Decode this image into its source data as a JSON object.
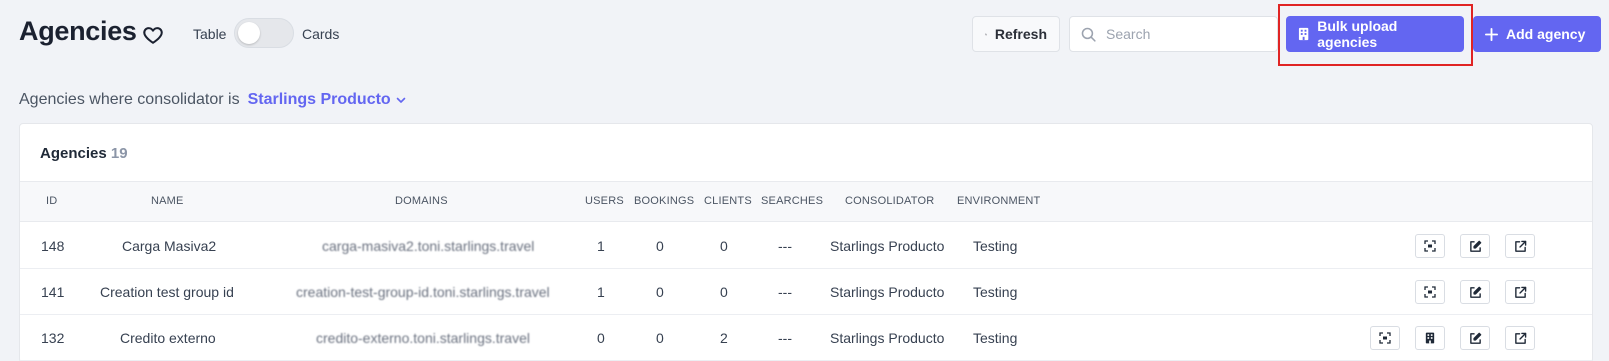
{
  "header": {
    "title": "Agencies",
    "view_toggle": {
      "left_label": "Table",
      "right_label": "Cards"
    },
    "refresh_label": "Refresh",
    "search_placeholder": "Search",
    "bulk_upload_label": "Bulk upload agencies",
    "add_agency_label": "Add agency"
  },
  "filter": {
    "prefix": "Agencies where consolidator is",
    "consolidator": "Starlings Producto"
  },
  "table": {
    "title": "Agencies",
    "count": "19",
    "columns": [
      "ID",
      "NAME",
      "DOMAINS",
      "USERS",
      "BOOKINGS",
      "CLIENTS",
      "SEARCHES",
      "CONSOLIDATOR",
      "ENVIRONMENT"
    ],
    "rows": [
      {
        "id": "148",
        "name": "Carga Masiva2",
        "domain": "carga-masiva2.toni.starlings.travel",
        "users": "1",
        "bookings": "0",
        "clients": "0",
        "searches": "---",
        "consolidator": "Starlings Producto",
        "environment": "Testing"
      },
      {
        "id": "141",
        "name": "Creation test group id",
        "domain": "creation-test-group-id.toni.starlings.travel",
        "users": "1",
        "bookings": "0",
        "clients": "0",
        "searches": "---",
        "consolidator": "Starlings Producto",
        "environment": "Testing"
      },
      {
        "id": "132",
        "name": "Credito externo",
        "domain": "credito-externo.toni.starlings.travel",
        "users": "0",
        "bookings": "0",
        "clients": "2",
        "searches": "---",
        "consolidator": "Starlings Producto",
        "environment": "Testing"
      }
    ]
  },
  "icons": {
    "heart": "heart-icon",
    "refresh": "refresh-icon",
    "search": "search-icon",
    "bulk": "building-icon",
    "add": "plus-icon",
    "scan": "scan-icon",
    "edit": "edit-icon",
    "open": "external-link-icon"
  },
  "colors": {
    "accent": "#6366f1",
    "highlight": "#e02424"
  }
}
